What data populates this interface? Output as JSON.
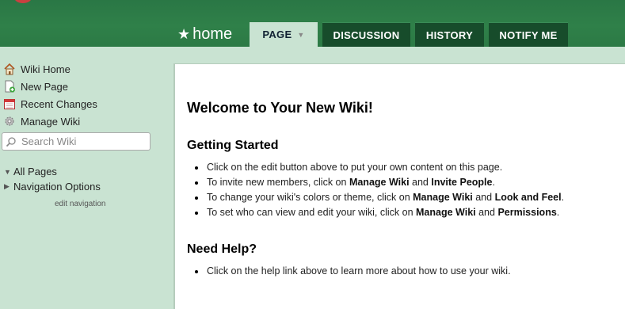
{
  "header": {
    "page_name": "home",
    "tabs": {
      "page": "PAGE",
      "discussion": "DISCUSSION",
      "history": "HISTORY",
      "notify": "NOTIFY ME"
    }
  },
  "sidebar": {
    "items": [
      {
        "label": "Wiki Home",
        "icon": "house-icon"
      },
      {
        "label": "New Page",
        "icon": "new-page-icon"
      },
      {
        "label": "Recent Changes",
        "icon": "calendar-icon"
      },
      {
        "label": "Manage Wiki",
        "icon": "gear-icon"
      }
    ],
    "search_placeholder": "Search Wiki",
    "tree": {
      "all_pages": "All Pages",
      "navigation_options": "Navigation Options"
    },
    "edit_navigation": "edit navigation"
  },
  "content": {
    "title": "Welcome to Your New Wiki!",
    "getting_started": {
      "heading": "Getting Started",
      "items": [
        {
          "pre": "Click on the edit button above to put your own content on this page."
        },
        {
          "pre": "To invite new members, click on ",
          "b1": "Manage Wiki",
          "mid": " and ",
          "b2": "Invite People",
          "post": "."
        },
        {
          "pre": "To change your wiki's colors or theme, click on ",
          "b1": "Manage Wiki",
          "mid": " and ",
          "b2": "Look and Feel",
          "post": "."
        },
        {
          "pre": "To set who can view and edit your wiki, click on ",
          "b1": "Manage Wiki",
          "mid": " and ",
          "b2": "Permissions",
          "post": "."
        }
      ]
    },
    "need_help": {
      "heading": "Need Help?",
      "items": [
        {
          "pre": "Click on the help link above to learn more about how to use your wiki."
        }
      ]
    }
  },
  "colors": {
    "header_green": "#2f8049",
    "tab_dark": "#174c2b",
    "sidebar_bg": "#c9e3d2"
  }
}
